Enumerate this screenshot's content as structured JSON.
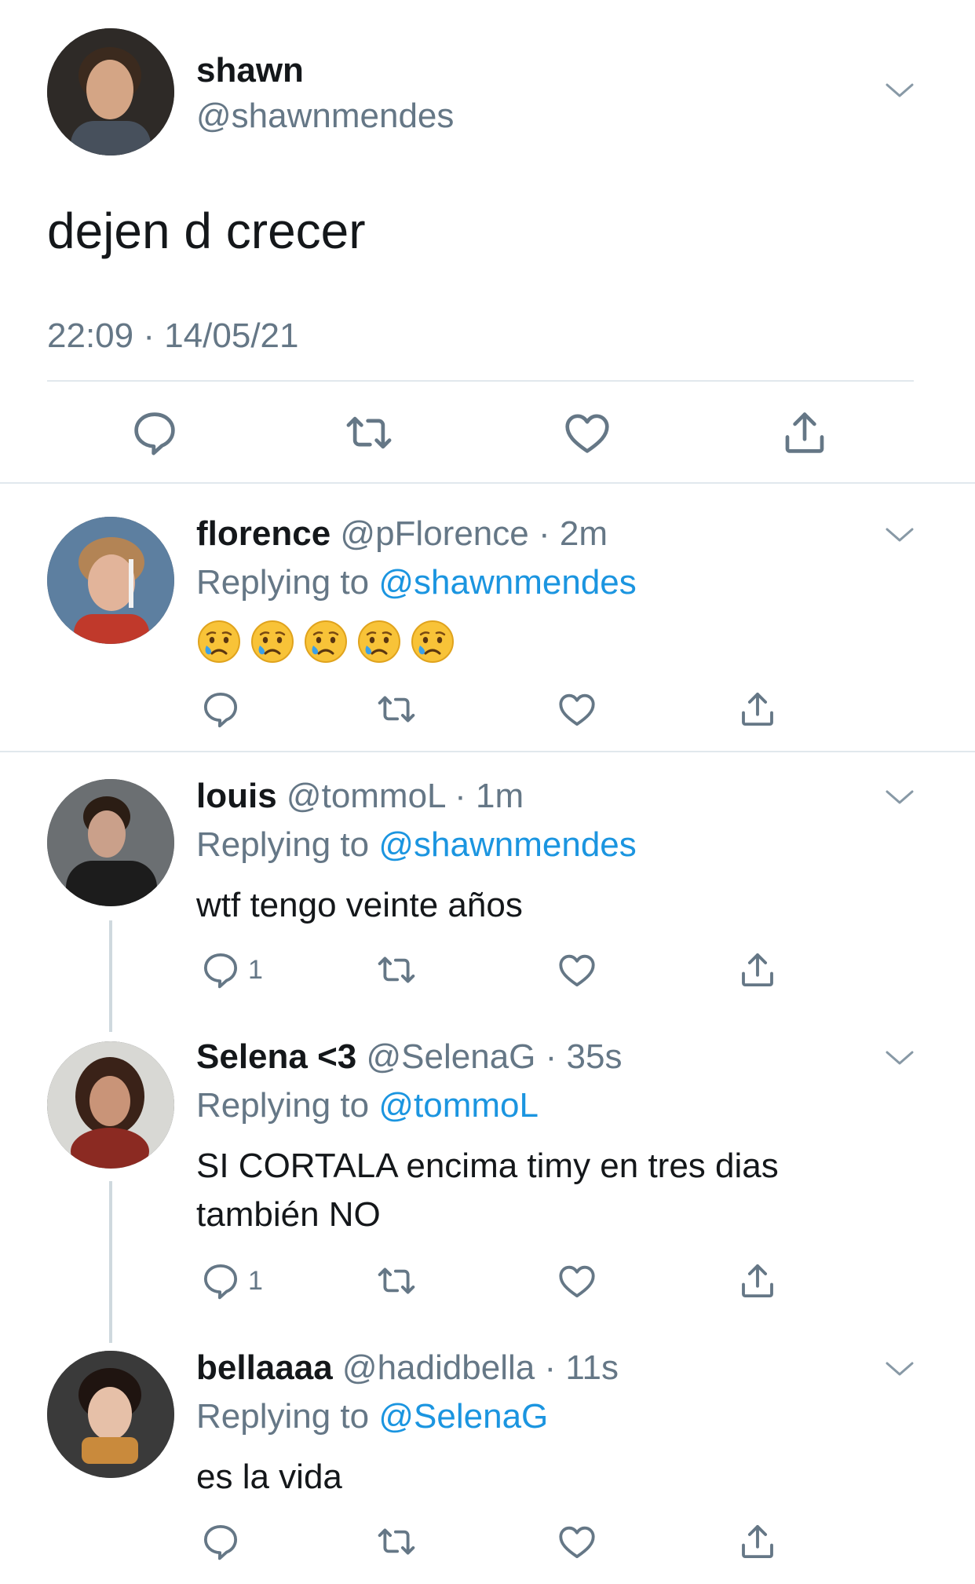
{
  "main_tweet": {
    "name": "shawn",
    "handle": "@shawnmendes",
    "text": "dejen d crecer",
    "timestamp": "22:09 · 14/05/21",
    "avatar_icon": "profile-photo-icon"
  },
  "replies": [
    {
      "name": "florence",
      "handle": "@pFlorence",
      "time": "· 2m",
      "replying_prefix": "Replying to",
      "replying_to": "@shawnmendes",
      "text": "",
      "emoji": [
        "crying-face-icon",
        "crying-face-icon",
        "crying-face-icon",
        "crying-face-icon",
        "crying-face-icon"
      ],
      "reply_count": ""
    },
    {
      "name": "louis",
      "handle": "@tommoL",
      "time": "· 1m",
      "replying_prefix": "Replying to",
      "replying_to": "@shawnmendes",
      "text": "wtf tengo veinte años",
      "reply_count": "1"
    },
    {
      "name": "Selena <3",
      "handle": "@SelenaG",
      "time": "· 35s",
      "replying_prefix": "Replying to",
      "replying_to": "@tommoL",
      "text_line1": "SI CORTALA encima timy en tres dias",
      "text_line2": "también NO",
      "reply_count": "1"
    },
    {
      "name": "bellaaaa",
      "handle": "@hadidbella",
      "time": "· 11s",
      "replying_prefix": "Replying to",
      "replying_to": "@SelenaG",
      "text": "es la vida",
      "reply_count": ""
    }
  ],
  "colors": {
    "text": "#14171a",
    "secondary": "#657786",
    "link": "#1b95e0",
    "divider": "#e1e8ed",
    "thread_line": "#cfd9de"
  }
}
